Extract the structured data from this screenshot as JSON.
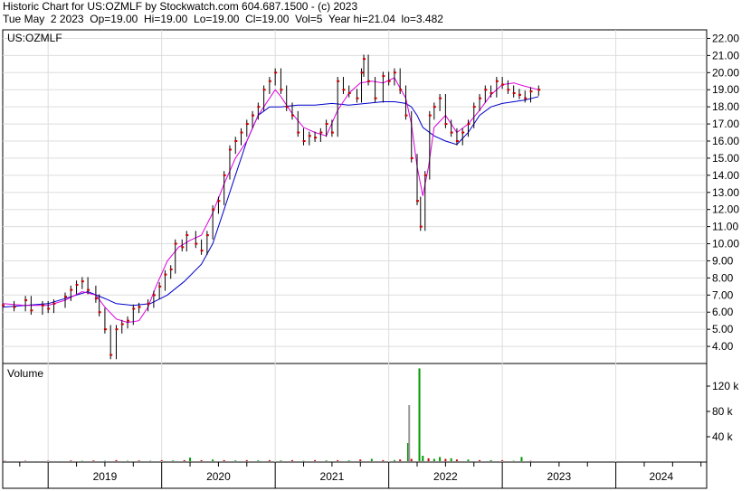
{
  "header": {
    "line1": "Historic Chart for US:OZMLF by Stockwatch.com 604.687.1500 - (c) 2023",
    "line2": "Tue May  2 2023  Op=19.00  Hi=19.00  Lo=19.00  Cl=19.00  Vol=5  Year hi=21.04  lo=3.482"
  },
  "chart_data": [
    {
      "type": "line",
      "title": "US:OZMLF",
      "x_axis_years": [
        "2019",
        "2020",
        "2021",
        "2022",
        "2023",
        "2024"
      ],
      "x_range": [
        2018.6,
        2024.8
      ],
      "ylim": [
        3,
        22.5
      ],
      "y_ticks": [
        "4.00",
        "5.00",
        "6.00",
        "7.00",
        "8.00",
        "9.00",
        "10.00",
        "11.00",
        "12.00",
        "13.00",
        "14.00",
        "15.00",
        "16.00",
        "17.00",
        "18.00",
        "19.00",
        "20.00",
        "21.00",
        "22.00"
      ],
      "grid": true,
      "series": [
        {
          "kind": "price_close",
          "color": "#cc0000",
          "points": [
            [
              2018.6,
              6.4
            ],
            [
              2018.7,
              6.3
            ],
            [
              2018.8,
              6.7
            ],
            [
              2018.85,
              6.1
            ],
            [
              2018.95,
              6.4
            ],
            [
              2019.0,
              6.2
            ],
            [
              2019.05,
              6.5
            ],
            [
              2019.15,
              6.9
            ],
            [
              2019.2,
              7.3
            ],
            [
              2019.25,
              7.6
            ],
            [
              2019.3,
              7.8
            ],
            [
              2019.35,
              7.3
            ],
            [
              2019.42,
              6.8
            ],
            [
              2019.45,
              6.0
            ],
            [
              2019.5,
              5.0
            ],
            [
              2019.55,
              3.5
            ],
            [
              2019.6,
              5.0
            ],
            [
              2019.65,
              5.3
            ],
            [
              2019.7,
              5.5
            ],
            [
              2019.75,
              6.2
            ],
            [
              2019.8,
              6.3
            ],
            [
              2019.88,
              6.5
            ],
            [
              2019.93,
              7.0
            ],
            [
              2019.98,
              7.5
            ],
            [
              2020.03,
              8.2
            ],
            [
              2020.08,
              8.5
            ],
            [
              2020.12,
              10.0
            ],
            [
              2020.18,
              9.8
            ],
            [
              2020.22,
              10.5
            ],
            [
              2020.3,
              10.0
            ],
            [
              2020.35,
              9.6
            ],
            [
              2020.4,
              10.5
            ],
            [
              2020.45,
              12.0
            ],
            [
              2020.5,
              12.5
            ],
            [
              2020.55,
              14.0
            ],
            [
              2020.6,
              15.5
            ],
            [
              2020.65,
              16.0
            ],
            [
              2020.7,
              16.5
            ],
            [
              2020.75,
              17.0
            ],
            [
              2020.8,
              17.5
            ],
            [
              2020.85,
              18.0
            ],
            [
              2020.9,
              19.0
            ],
            [
              2020.95,
              19.5
            ],
            [
              2021.0,
              20.0
            ],
            [
              2021.05,
              19.0
            ],
            [
              2021.1,
              18.0
            ],
            [
              2021.15,
              17.5
            ],
            [
              2021.2,
              16.5
            ],
            [
              2021.25,
              16.0
            ],
            [
              2021.3,
              16.3
            ],
            [
              2021.35,
              16.2
            ],
            [
              2021.4,
              16.5
            ],
            [
              2021.45,
              17.0
            ],
            [
              2021.5,
              16.5
            ],
            [
              2021.55,
              19.5
            ],
            [
              2021.6,
              19.0
            ],
            [
              2021.65,
              18.8
            ],
            [
              2021.72,
              18.5
            ],
            [
              2021.76,
              20.0
            ],
            [
              2021.78,
              20.8
            ],
            [
              2021.82,
              19.5
            ],
            [
              2021.88,
              18.5
            ],
            [
              2021.95,
              19.8
            ],
            [
              2022.0,
              19.5
            ],
            [
              2022.05,
              20.0
            ],
            [
              2022.1,
              19.0
            ],
            [
              2022.15,
              17.5
            ],
            [
              2022.2,
              15.0
            ],
            [
              2022.25,
              12.5
            ],
            [
              2022.28,
              11.0
            ],
            [
              2022.32,
              14.0
            ],
            [
              2022.36,
              17.5
            ],
            [
              2022.4,
              18.0
            ],
            [
              2022.45,
              18.5
            ],
            [
              2022.5,
              17.0
            ],
            [
              2022.55,
              16.5
            ],
            [
              2022.6,
              16.0
            ],
            [
              2022.65,
              16.5
            ],
            [
              2022.7,
              17.0
            ],
            [
              2022.75,
              18.0
            ],
            [
              2022.8,
              18.5
            ],
            [
              2022.85,
              19.0
            ],
            [
              2022.9,
              18.8
            ],
            [
              2022.95,
              19.5
            ],
            [
              2023.0,
              19.3
            ],
            [
              2023.05,
              19.0
            ],
            [
              2023.1,
              18.8
            ],
            [
              2023.15,
              18.7
            ],
            [
              2023.2,
              18.5
            ],
            [
              2023.25,
              18.9
            ],
            [
              2023.32,
              19.0
            ]
          ]
        },
        {
          "kind": "moving_average_short",
          "color": "#dd00dd",
          "points": [
            [
              2018.6,
              6.5
            ],
            [
              2018.8,
              6.4
            ],
            [
              2019.0,
              6.4
            ],
            [
              2019.15,
              6.7
            ],
            [
              2019.3,
              7.2
            ],
            [
              2019.42,
              7.0
            ],
            [
              2019.5,
              6.3
            ],
            [
              2019.6,
              5.6
            ],
            [
              2019.7,
              5.4
            ],
            [
              2019.8,
              5.5
            ],
            [
              2019.88,
              6.3
            ],
            [
              2019.95,
              7.5
            ],
            [
              2020.05,
              9.0
            ],
            [
              2020.15,
              9.8
            ],
            [
              2020.25,
              10.2
            ],
            [
              2020.35,
              10.5
            ],
            [
              2020.45,
              11.8
            ],
            [
              2020.55,
              13.5
            ],
            [
              2020.65,
              15.0
            ],
            [
              2020.75,
              16.0
            ],
            [
              2020.85,
              17.5
            ],
            [
              2020.95,
              18.5
            ],
            [
              2021.0,
              19.0
            ],
            [
              2021.05,
              18.6
            ],
            [
              2021.15,
              17.6
            ],
            [
              2021.25,
              16.8
            ],
            [
              2021.35,
              16.5
            ],
            [
              2021.45,
              16.3
            ],
            [
              2021.55,
              17.8
            ],
            [
              2021.65,
              18.8
            ],
            [
              2021.75,
              19.4
            ],
            [
              2021.85,
              19.5
            ],
            [
              2021.95,
              19.4
            ],
            [
              2022.05,
              19.7
            ],
            [
              2022.15,
              18.5
            ],
            [
              2022.2,
              17.0
            ],
            [
              2022.25,
              14.5
            ],
            [
              2022.3,
              12.8
            ],
            [
              2022.35,
              14.5
            ],
            [
              2022.4,
              16.8
            ],
            [
              2022.5,
              17.5
            ],
            [
              2022.6,
              16.5
            ],
            [
              2022.7,
              17.0
            ],
            [
              2022.8,
              17.8
            ],
            [
              2022.9,
              18.7
            ],
            [
              2023.0,
              19.3
            ],
            [
              2023.1,
              19.4
            ],
            [
              2023.2,
              19.2
            ],
            [
              2023.32,
              19.0
            ]
          ]
        },
        {
          "kind": "moving_average_long",
          "color": "#0000cc",
          "points": [
            [
              2018.6,
              6.3
            ],
            [
              2018.8,
              6.4
            ],
            [
              2019.0,
              6.5
            ],
            [
              2019.2,
              6.9
            ],
            [
              2019.35,
              7.2
            ],
            [
              2019.5,
              6.8
            ],
            [
              2019.6,
              6.5
            ],
            [
              2019.75,
              6.4
            ],
            [
              2019.9,
              6.5
            ],
            [
              2020.05,
              7.0
            ],
            [
              2020.2,
              7.8
            ],
            [
              2020.35,
              8.8
            ],
            [
              2020.45,
              10.0
            ],
            [
              2020.55,
              12.0
            ],
            [
              2020.65,
              14.0
            ],
            [
              2020.75,
              16.0
            ],
            [
              2020.85,
              17.5
            ],
            [
              2020.95,
              18.0
            ],
            [
              2021.05,
              18.0
            ],
            [
              2021.2,
              18.1
            ],
            [
              2021.35,
              18.1
            ],
            [
              2021.5,
              18.2
            ],
            [
              2021.65,
              18.1
            ],
            [
              2021.8,
              18.2
            ],
            [
              2021.95,
              18.3
            ],
            [
              2022.05,
              18.3
            ],
            [
              2022.15,
              18.2
            ],
            [
              2022.2,
              18.0
            ],
            [
              2022.25,
              17.5
            ],
            [
              2022.3,
              16.8
            ],
            [
              2022.4,
              16.3
            ],
            [
              2022.5,
              16.0
            ],
            [
              2022.6,
              15.8
            ],
            [
              2022.7,
              16.5
            ],
            [
              2022.8,
              17.5
            ],
            [
              2022.9,
              18.0
            ],
            [
              2023.0,
              18.2
            ],
            [
              2023.1,
              18.3
            ],
            [
              2023.2,
              18.4
            ],
            [
              2023.32,
              18.6
            ]
          ]
        }
      ]
    },
    {
      "type": "bar",
      "title": "Volume",
      "ylim": [
        0,
        150
      ],
      "y_ticks": [
        "40 k",
        "80 k",
        "120 k"
      ],
      "y_tick_values": [
        40,
        80,
        120
      ],
      "bars": [
        {
          "x": 2018.62,
          "v": 2,
          "color": "#cc0000"
        },
        {
          "x": 2018.7,
          "v": 1.5,
          "color": "#009900"
        },
        {
          "x": 2018.8,
          "v": 2,
          "color": "#cc0000"
        },
        {
          "x": 2018.9,
          "v": 1.5,
          "color": "#009900"
        },
        {
          "x": 2019.0,
          "v": 2,
          "color": "#cc0000"
        },
        {
          "x": 2019.1,
          "v": 1.5,
          "color": "#009900"
        },
        {
          "x": 2019.2,
          "v": 2.5,
          "color": "#cc0000"
        },
        {
          "x": 2019.3,
          "v": 2,
          "color": "#009900"
        },
        {
          "x": 2019.4,
          "v": 2.5,
          "color": "#cc0000"
        },
        {
          "x": 2019.5,
          "v": 2,
          "color": "#009900"
        },
        {
          "x": 2019.6,
          "v": 3,
          "color": "#cc0000"
        },
        {
          "x": 2019.7,
          "v": 2,
          "color": "#009900"
        },
        {
          "x": 2019.8,
          "v": 2.5,
          "color": "#cc0000"
        },
        {
          "x": 2019.9,
          "v": 2,
          "color": "#009900"
        },
        {
          "x": 2020.0,
          "v": 3,
          "color": "#cc0000"
        },
        {
          "x": 2020.1,
          "v": 2.5,
          "color": "#009900"
        },
        {
          "x": 2020.2,
          "v": 3,
          "color": "#cc0000"
        },
        {
          "x": 2020.25,
          "v": 7,
          "color": "#009900"
        },
        {
          "x": 2020.35,
          "v": 3,
          "color": "#cc0000"
        },
        {
          "x": 2020.45,
          "v": 4,
          "color": "#009900"
        },
        {
          "x": 2020.55,
          "v": 3,
          "color": "#cc0000"
        },
        {
          "x": 2020.65,
          "v": 2.5,
          "color": "#009900"
        },
        {
          "x": 2020.75,
          "v": 3,
          "color": "#cc0000"
        },
        {
          "x": 2020.85,
          "v": 2.5,
          "color": "#009900"
        },
        {
          "x": 2020.95,
          "v": 3,
          "color": "#cc0000"
        },
        {
          "x": 2021.05,
          "v": 2.5,
          "color": "#009900"
        },
        {
          "x": 2021.15,
          "v": 3,
          "color": "#cc0000"
        },
        {
          "x": 2021.25,
          "v": 2,
          "color": "#009900"
        },
        {
          "x": 2021.35,
          "v": 3,
          "color": "#cc0000"
        },
        {
          "x": 2021.45,
          "v": 2.5,
          "color": "#009900"
        },
        {
          "x": 2021.55,
          "v": 3,
          "color": "#cc0000"
        },
        {
          "x": 2021.65,
          "v": 2.5,
          "color": "#009900"
        },
        {
          "x": 2021.75,
          "v": 4,
          "color": "#cc0000"
        },
        {
          "x": 2021.85,
          "v": 5,
          "color": "#009900"
        },
        {
          "x": 2021.95,
          "v": 3,
          "color": "#cc0000"
        },
        {
          "x": 2022.05,
          "v": 3,
          "color": "#009900"
        },
        {
          "x": 2022.1,
          "v": 4,
          "color": "#cc0000"
        },
        {
          "x": 2022.17,
          "v": 30,
          "color": "#009900"
        },
        {
          "x": 2022.18,
          "v": 90,
          "color": "#999999"
        },
        {
          "x": 2022.2,
          "v": 5,
          "color": "#cc0000"
        },
        {
          "x": 2022.27,
          "v": 148,
          "color": "#009900"
        },
        {
          "x": 2022.3,
          "v": 10,
          "color": "#009900"
        },
        {
          "x": 2022.35,
          "v": 6,
          "color": "#cc0000"
        },
        {
          "x": 2022.4,
          "v": 5,
          "color": "#009900"
        },
        {
          "x": 2022.45,
          "v": 8,
          "color": "#009900"
        },
        {
          "x": 2022.5,
          "v": 5,
          "color": "#cc0000"
        },
        {
          "x": 2022.55,
          "v": 6,
          "color": "#009900"
        },
        {
          "x": 2022.6,
          "v": 4,
          "color": "#cc0000"
        },
        {
          "x": 2022.7,
          "v": 4,
          "color": "#009900"
        },
        {
          "x": 2022.8,
          "v": 3,
          "color": "#cc0000"
        },
        {
          "x": 2022.9,
          "v": 3,
          "color": "#009900"
        },
        {
          "x": 2023.0,
          "v": 3,
          "color": "#cc0000"
        },
        {
          "x": 2023.1,
          "v": 2,
          "color": "#009900"
        },
        {
          "x": 2023.17,
          "v": 8,
          "color": "#009900"
        },
        {
          "x": 2023.25,
          "v": 2,
          "color": "#cc0000"
        }
      ]
    }
  ]
}
